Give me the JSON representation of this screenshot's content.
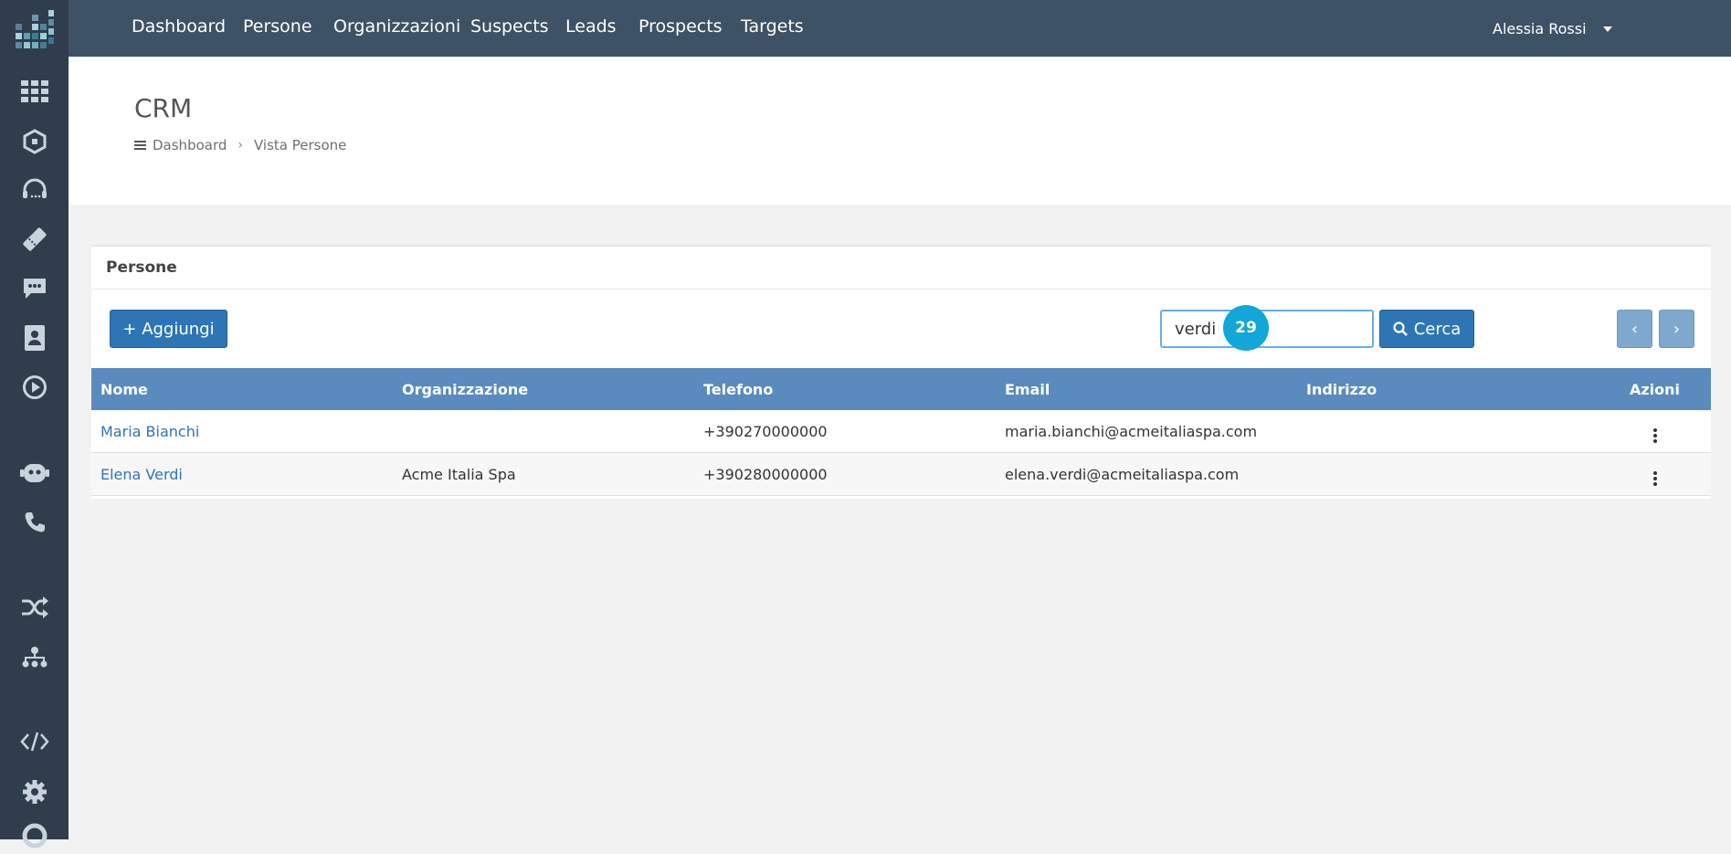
{
  "topbar": {
    "nav": [
      "Dashboard",
      "Persone",
      "Organizzazioni",
      "Suspects",
      "Leads",
      "Prospects",
      "Targets"
    ],
    "user_name": "Alessia Rossi"
  },
  "sidebar": {
    "icons": [
      "grid-icon",
      "box-icon",
      "headset-icon",
      "ticket-icon",
      "chat-icon",
      "contacts-icon",
      "play-icon",
      "bot-icon",
      "phone-icon",
      "shuffle-icon",
      "org-chart-icon",
      "code-icon",
      "gear-icon",
      "lifebuoy-icon"
    ]
  },
  "header": {
    "title": "CRM",
    "breadcrumb": [
      "Dashboard",
      "Vista Persone"
    ]
  },
  "panel": {
    "heading": "Persone",
    "add_label": "+ Aggiungi",
    "search_value": "verdi",
    "step_badge": "29",
    "search_label": "Cerca",
    "prev_label": "‹",
    "next_label": "›"
  },
  "table": {
    "columns": [
      "Nome",
      "Organizzazione",
      "Telefono",
      "Email",
      "Indirizzo",
      "Azioni"
    ],
    "rows": [
      {
        "nome": "Maria Bianchi",
        "organizzazione": "",
        "telefono": "+390270000000",
        "email": "maria.bianchi@acmeitaliaspa.com",
        "indirizzo": ""
      },
      {
        "nome": "Elena Verdi",
        "organizzazione": "Acme Italia Spa",
        "telefono": "+390280000000",
        "email": "elena.verdi@acmeitaliaspa.com",
        "indirizzo": ""
      }
    ]
  },
  "colors": {
    "sidebar_bg": "#2f3d4c",
    "topbar_bg": "#3e5266",
    "primary": "#2e75b6",
    "table_header": "#598bbf",
    "badge": "#12a6d9"
  }
}
